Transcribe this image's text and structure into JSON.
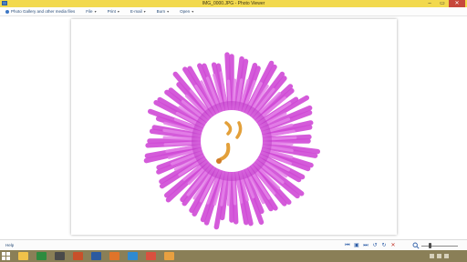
{
  "window": {
    "title": "IMG_0000.JPG - Photo Viewer",
    "controls": [
      "–",
      "▭",
      "✕"
    ]
  },
  "menu": {
    "items": [
      {
        "label": "Photo Gallery and other media files",
        "icon": "back-icon"
      },
      {
        "label": "File",
        "caret": "▾"
      },
      {
        "label": "Print",
        "caret": "▾"
      },
      {
        "label": "E-mail",
        "caret": "▾"
      },
      {
        "label": "Burn",
        "caret": "▾"
      },
      {
        "label": "Open",
        "caret": "▾"
      }
    ]
  },
  "image": {
    "subject": "pink ice plant flower",
    "petal_color": "#d04ad6",
    "center_color": "#ffffff",
    "stamen_color": "#e3a03a"
  },
  "controlbar": {
    "help_label": "Help",
    "buttons": [
      {
        "name": "previous-button",
        "glyph": "⏮"
      },
      {
        "name": "slideshow-button",
        "glyph": "▣"
      },
      {
        "name": "next-button",
        "glyph": "⏭"
      },
      {
        "name": "rotate-left-button",
        "glyph": "↺"
      },
      {
        "name": "rotate-right-button",
        "glyph": "↻"
      },
      {
        "name": "delete-button",
        "glyph": "✕"
      }
    ],
    "zoom_icon": "magnifier-icon"
  },
  "taskbar": {
    "apps": [
      {
        "name": "file-explorer",
        "color": "#f0c24a"
      },
      {
        "name": "excel",
        "color": "#2e8b3e"
      },
      {
        "name": "store",
        "color": "#4a4a4a"
      },
      {
        "name": "powerpoint",
        "color": "#c8502a"
      },
      {
        "name": "monitor",
        "color": "#2b5aa0"
      },
      {
        "name": "firefox",
        "color": "#e0742a"
      },
      {
        "name": "edge",
        "color": "#2f8ad1"
      },
      {
        "name": "chrome",
        "color": "#d9503f"
      },
      {
        "name": "photo-viewer",
        "color": "#e8a040"
      }
    ],
    "clock": {
      "time": "",
      "date": ""
    }
  }
}
